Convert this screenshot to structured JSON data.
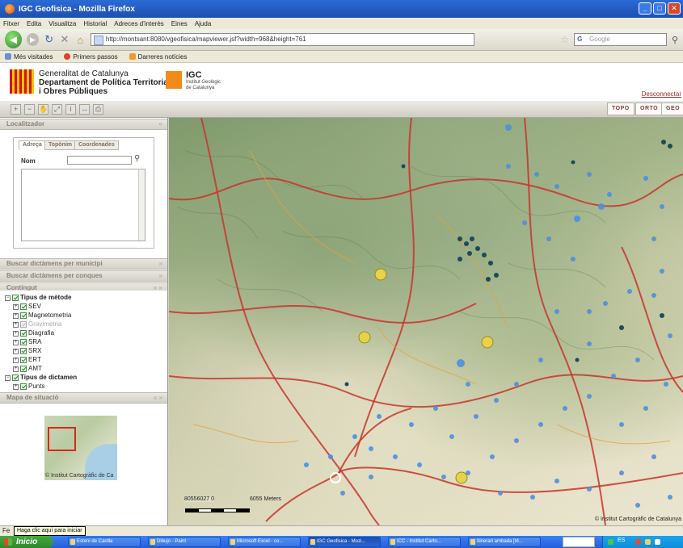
{
  "browser": {
    "title": "IGC Geofisica - Mozilla Firefox",
    "menu": [
      "Fitxer",
      "Edita",
      "Visualitza",
      "Historial",
      "Adreces d'interès",
      "Eines",
      "Ajuda"
    ],
    "url": "http://montsant:8080/vgeofisica/mapviewer.jsf?width=968&height=761",
    "search_placeholder": "Google",
    "bookmarks": [
      "Més visitades",
      "Primers passos",
      "Darreres notícies"
    ]
  },
  "header": {
    "gencat_line1": "Generalitat de Catalunya",
    "gencat_line2": "Departament de Política Territorial",
    "gencat_line3": "i Obres Públiques",
    "igc_name": "IGC",
    "igc_sub1": "Institut Geològic",
    "igc_sub2": "de Catalunya",
    "logout": "Desconnectar"
  },
  "toolbar": {
    "map_buttons": [
      "TOPO",
      "ORTO",
      "GEO"
    ]
  },
  "panels": {
    "localitzador": "Localitzador",
    "tabs": [
      "Adreça",
      "Topònim",
      "Coordenades"
    ],
    "nom_label": "Nom",
    "buscar_municipi": "Buscar dictàmens per municipi",
    "buscar_conques": "Buscar dictàmens per conques",
    "contingut": "Contingut",
    "mapa_situacio": "Mapa de situació",
    "mapa_copy": "© Institut Cartogràfic de Ca"
  },
  "tree": {
    "group1": "Tipus de mètode",
    "items": [
      "SEV",
      "Magnetometria",
      "Gravimetria",
      "Diagrafia",
      "SRA",
      "SRX",
      "ERT",
      "AMT"
    ],
    "group2": "Tipus de dictamen",
    "group2_items": [
      "Punts"
    ]
  },
  "map": {
    "scale_coords": "80556027  0",
    "scale_label": "6055 Meters",
    "copyright": "© Institut Cartogràfic de Catalunya"
  },
  "statusbar": {
    "text": "Fe",
    "tooltip": "Haga clic aquí para iniciar"
  },
  "taskbar": {
    "start": "Inicio",
    "items": [
      "Esteni de Cardla",
      "Dibujo - Paint",
      "Microsoft Excel - co...",
      "IGC Geofisica - Mozi...",
      "ICC - Institut Carto...",
      "Itinerari ambada [M..."
    ],
    "lang": "ES"
  },
  "colors": {
    "title_blue": "#2a6bd6",
    "road_red": "#c8342d",
    "point_blue": "#4c8fe0",
    "point_dark": "#1d4a5c",
    "point_yellow": "#e8d24a"
  }
}
